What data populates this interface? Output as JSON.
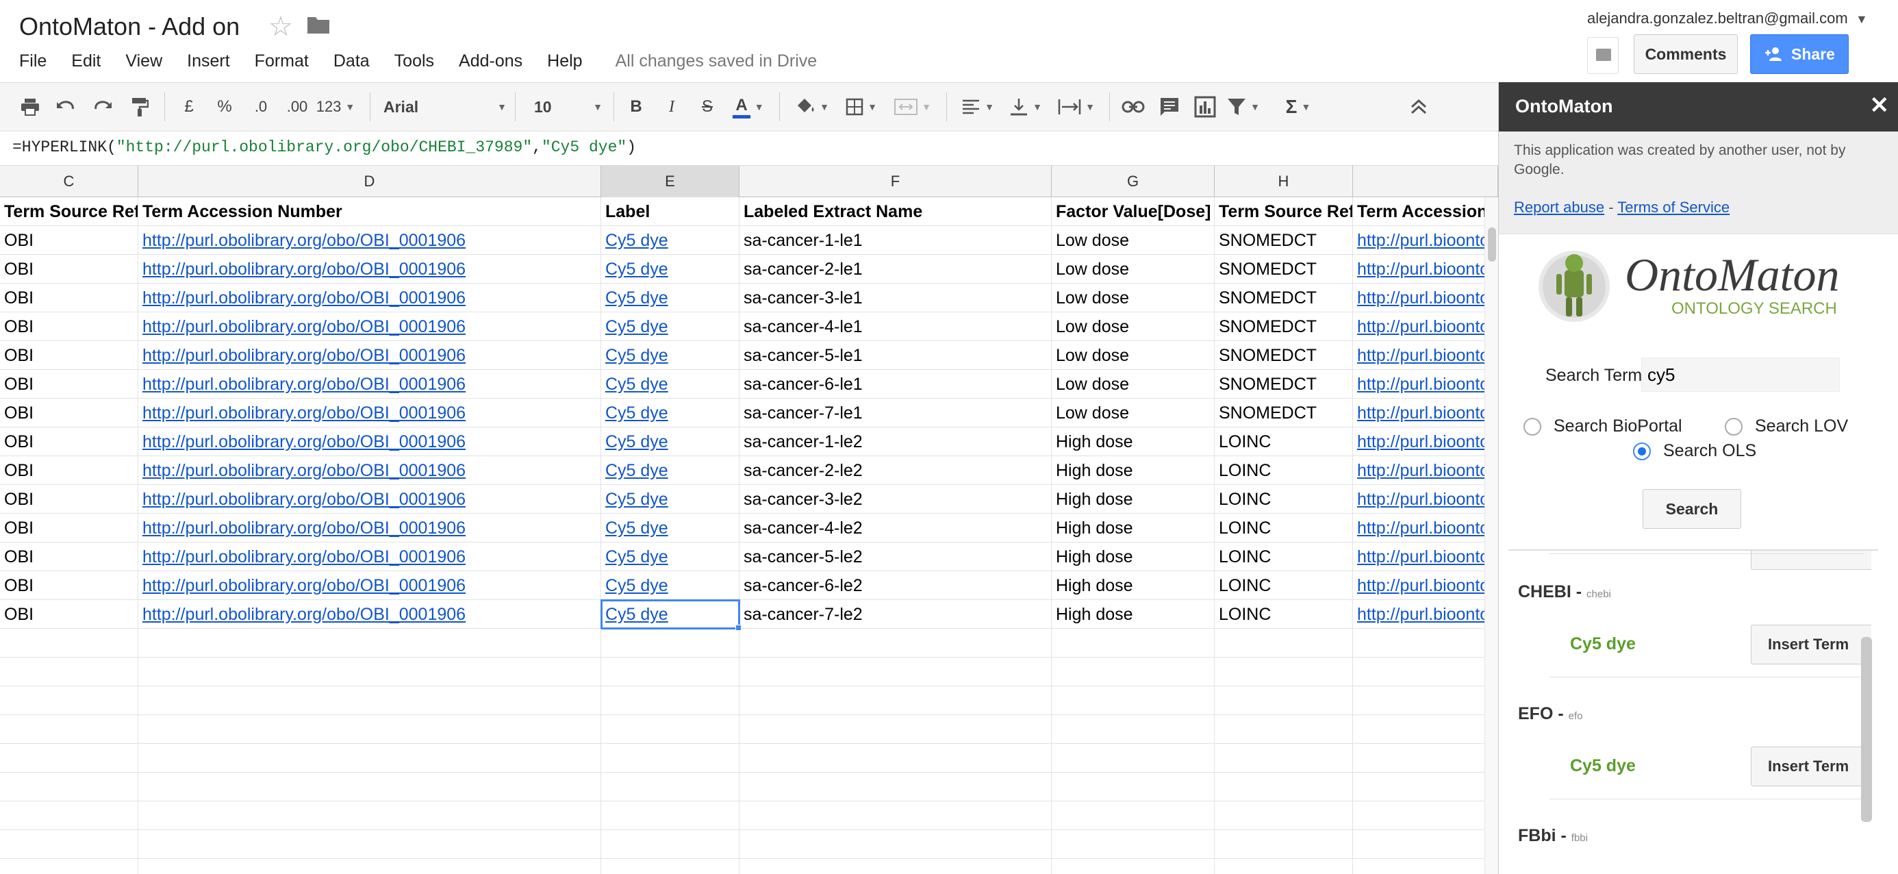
{
  "app": {
    "doc_title": "OntoMaton - Add on",
    "user_email": "alejandra.gonzalez.beltran@gmail.com",
    "saved_status": "All changes saved in Drive",
    "comments_label": "Comments",
    "share_label": "Share"
  },
  "menu": [
    "File",
    "Edit",
    "View",
    "Insert",
    "Format",
    "Data",
    "Tools",
    "Add-ons",
    "Help"
  ],
  "toolbar": {
    "currency": "£",
    "percent": "%",
    "dec_less": ".0",
    "dec_more": ".00",
    "number_format": "123",
    "font_name": "Arial",
    "font_size": "10",
    "bold": "B",
    "italic": "I",
    "strike": "S",
    "text_color": "A",
    "sum": "Σ"
  },
  "formula": {
    "prefix": "=HYPERLINK(",
    "url": "\"http://purl.obolibrary.org/obo/CHEBI_37989\"",
    "comma": ",",
    "text": "\"Cy5 dye\"",
    "suffix": ")"
  },
  "grid": {
    "columns": [
      "C",
      "D",
      "E",
      "F",
      "G",
      "H",
      ""
    ],
    "selected_column": "E",
    "header_row": [
      "Term Source Ref",
      "Term Accession Number",
      "Label",
      "Labeled Extract Name",
      "Factor Value[Dose]",
      "Term Source Ref",
      "Term Accession Number"
    ],
    "rows": [
      [
        "OBI",
        "http://purl.obolibrary.org/obo/OBI_0001906",
        "Cy5 dye",
        "sa-cancer-1-le1",
        "Low dose",
        "SNOMEDCT",
        "http://purl.bioontology.org"
      ],
      [
        "OBI",
        "http://purl.obolibrary.org/obo/OBI_0001906",
        "Cy5 dye",
        "sa-cancer-2-le1",
        "Low dose",
        "SNOMEDCT",
        "http://purl.bioontology.org"
      ],
      [
        "OBI",
        "http://purl.obolibrary.org/obo/OBI_0001906",
        "Cy5 dye",
        "sa-cancer-3-le1",
        "Low dose",
        "SNOMEDCT",
        "http://purl.bioontology.org"
      ],
      [
        "OBI",
        "http://purl.obolibrary.org/obo/OBI_0001906",
        "Cy5 dye",
        "sa-cancer-4-le1",
        "Low dose",
        "SNOMEDCT",
        "http://purl.bioontology.org"
      ],
      [
        "OBI",
        "http://purl.obolibrary.org/obo/OBI_0001906",
        "Cy5 dye",
        "sa-cancer-5-le1",
        "Low dose",
        "SNOMEDCT",
        "http://purl.bioontology.org"
      ],
      [
        "OBI",
        "http://purl.obolibrary.org/obo/OBI_0001906",
        "Cy5 dye",
        "sa-cancer-6-le1",
        "Low dose",
        "SNOMEDCT",
        "http://purl.bioontology.org"
      ],
      [
        "OBI",
        "http://purl.obolibrary.org/obo/OBI_0001906",
        "Cy5 dye",
        "sa-cancer-7-le1",
        "Low dose",
        "SNOMEDCT",
        "http://purl.bioontology.org"
      ],
      [
        "OBI",
        "http://purl.obolibrary.org/obo/OBI_0001906",
        "Cy5 dye",
        "sa-cancer-1-le2",
        "High dose",
        "LOINC",
        "http://purl.bioontology.org"
      ],
      [
        "OBI",
        "http://purl.obolibrary.org/obo/OBI_0001906",
        "Cy5 dye",
        "sa-cancer-2-le2",
        "High dose",
        "LOINC",
        "http://purl.bioontology.org"
      ],
      [
        "OBI",
        "http://purl.obolibrary.org/obo/OBI_0001906",
        "Cy5 dye",
        "sa-cancer-3-le2",
        "High dose",
        "LOINC",
        "http://purl.bioontology.org"
      ],
      [
        "OBI",
        "http://purl.obolibrary.org/obo/OBI_0001906",
        "Cy5 dye",
        "sa-cancer-4-le2",
        "High dose",
        "LOINC",
        "http://purl.bioontology.org"
      ],
      [
        "OBI",
        "http://purl.obolibrary.org/obo/OBI_0001906",
        "Cy5 dye",
        "sa-cancer-5-le2",
        "High dose",
        "LOINC",
        "http://purl.bioontology.org"
      ],
      [
        "OBI",
        "http://purl.obolibrary.org/obo/OBI_0001906",
        "Cy5 dye",
        "sa-cancer-6-le2",
        "High dose",
        "LOINC",
        "http://purl.bioontology.org"
      ],
      [
        "OBI",
        "http://purl.obolibrary.org/obo/OBI_0001906",
        "Cy5 dye",
        "sa-cancer-7-le2",
        "High dose",
        "LOINC",
        "http://purl.bioontology.org"
      ]
    ],
    "link_columns": [
      1,
      2,
      6
    ],
    "selected_cell": {
      "row": 13,
      "col": 2
    }
  },
  "sidebar": {
    "title": "OntoMaton",
    "close": "✕",
    "notice": "This application was created by another user, not by Google.",
    "report_abuse": "Report abuse",
    "link_sep": " - ",
    "terms": "Terms of Service",
    "logo_text": "OntoMaton",
    "logo_subtext": "ONTOLOGY SEARCH",
    "search_term_label": "Search Term",
    "search_value": "cy5",
    "radio_bioportal": "Search BioPortal",
    "radio_lov": "Search LOV",
    "radio_ols": "Search OLS",
    "selected_radio": "ols",
    "search_button": "Search",
    "results": [
      {
        "ontology": "CHEBI",
        "abbr": "chebi",
        "term": "Cy5 dye",
        "button": "Insert Term"
      },
      {
        "ontology": "EFO",
        "abbr": "efo",
        "term": "Cy5 dye",
        "button": "Insert Term"
      },
      {
        "ontology": "FBbi",
        "abbr": "fbbi",
        "term": "",
        "button": ""
      }
    ]
  },
  "colors": {
    "link": "#1155cc",
    "share_blue": "#4d90fe",
    "sidebar_header": "#3a3a3a",
    "term_green": "#5a9e2b",
    "selection_blue": "#4285f4"
  }
}
